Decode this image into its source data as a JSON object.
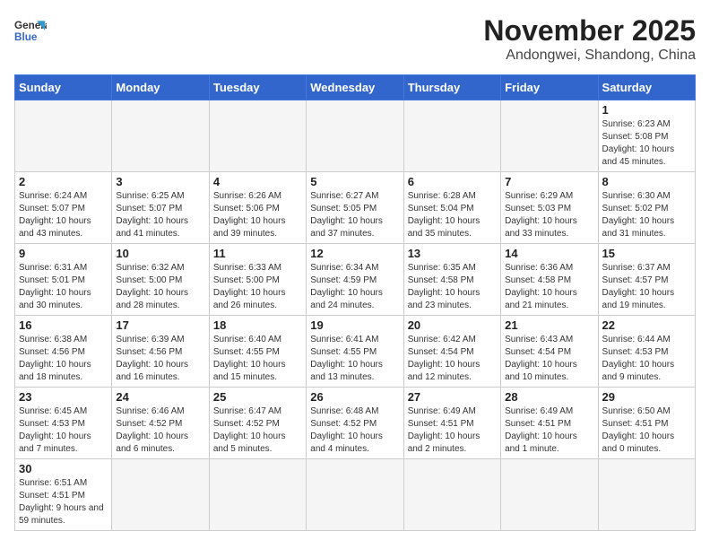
{
  "header": {
    "logo_line1": "General",
    "logo_line2": "Blue",
    "title": "November 2025",
    "subtitle": "Andongwei, Shandong, China"
  },
  "weekdays": [
    "Sunday",
    "Monday",
    "Tuesday",
    "Wednesday",
    "Thursday",
    "Friday",
    "Saturday"
  ],
  "weeks": [
    [
      {
        "day": "",
        "info": ""
      },
      {
        "day": "",
        "info": ""
      },
      {
        "day": "",
        "info": ""
      },
      {
        "day": "",
        "info": ""
      },
      {
        "day": "",
        "info": ""
      },
      {
        "day": "",
        "info": ""
      },
      {
        "day": "1",
        "info": "Sunrise: 6:23 AM\nSunset: 5:08 PM\nDaylight: 10 hours and 45 minutes."
      }
    ],
    [
      {
        "day": "2",
        "info": "Sunrise: 6:24 AM\nSunset: 5:07 PM\nDaylight: 10 hours and 43 minutes."
      },
      {
        "day": "3",
        "info": "Sunrise: 6:25 AM\nSunset: 5:07 PM\nDaylight: 10 hours and 41 minutes."
      },
      {
        "day": "4",
        "info": "Sunrise: 6:26 AM\nSunset: 5:06 PM\nDaylight: 10 hours and 39 minutes."
      },
      {
        "day": "5",
        "info": "Sunrise: 6:27 AM\nSunset: 5:05 PM\nDaylight: 10 hours and 37 minutes."
      },
      {
        "day": "6",
        "info": "Sunrise: 6:28 AM\nSunset: 5:04 PM\nDaylight: 10 hours and 35 minutes."
      },
      {
        "day": "7",
        "info": "Sunrise: 6:29 AM\nSunset: 5:03 PM\nDaylight: 10 hours and 33 minutes."
      },
      {
        "day": "8",
        "info": "Sunrise: 6:30 AM\nSunset: 5:02 PM\nDaylight: 10 hours and 31 minutes."
      }
    ],
    [
      {
        "day": "9",
        "info": "Sunrise: 6:31 AM\nSunset: 5:01 PM\nDaylight: 10 hours and 30 minutes."
      },
      {
        "day": "10",
        "info": "Sunrise: 6:32 AM\nSunset: 5:00 PM\nDaylight: 10 hours and 28 minutes."
      },
      {
        "day": "11",
        "info": "Sunrise: 6:33 AM\nSunset: 5:00 PM\nDaylight: 10 hours and 26 minutes."
      },
      {
        "day": "12",
        "info": "Sunrise: 6:34 AM\nSunset: 4:59 PM\nDaylight: 10 hours and 24 minutes."
      },
      {
        "day": "13",
        "info": "Sunrise: 6:35 AM\nSunset: 4:58 PM\nDaylight: 10 hours and 23 minutes."
      },
      {
        "day": "14",
        "info": "Sunrise: 6:36 AM\nSunset: 4:58 PM\nDaylight: 10 hours and 21 minutes."
      },
      {
        "day": "15",
        "info": "Sunrise: 6:37 AM\nSunset: 4:57 PM\nDaylight: 10 hours and 19 minutes."
      }
    ],
    [
      {
        "day": "16",
        "info": "Sunrise: 6:38 AM\nSunset: 4:56 PM\nDaylight: 10 hours and 18 minutes."
      },
      {
        "day": "17",
        "info": "Sunrise: 6:39 AM\nSunset: 4:56 PM\nDaylight: 10 hours and 16 minutes."
      },
      {
        "day": "18",
        "info": "Sunrise: 6:40 AM\nSunset: 4:55 PM\nDaylight: 10 hours and 15 minutes."
      },
      {
        "day": "19",
        "info": "Sunrise: 6:41 AM\nSunset: 4:55 PM\nDaylight: 10 hours and 13 minutes."
      },
      {
        "day": "20",
        "info": "Sunrise: 6:42 AM\nSunset: 4:54 PM\nDaylight: 10 hours and 12 minutes."
      },
      {
        "day": "21",
        "info": "Sunrise: 6:43 AM\nSunset: 4:54 PM\nDaylight: 10 hours and 10 minutes."
      },
      {
        "day": "22",
        "info": "Sunrise: 6:44 AM\nSunset: 4:53 PM\nDaylight: 10 hours and 9 minutes."
      }
    ],
    [
      {
        "day": "23",
        "info": "Sunrise: 6:45 AM\nSunset: 4:53 PM\nDaylight: 10 hours and 7 minutes."
      },
      {
        "day": "24",
        "info": "Sunrise: 6:46 AM\nSunset: 4:52 PM\nDaylight: 10 hours and 6 minutes."
      },
      {
        "day": "25",
        "info": "Sunrise: 6:47 AM\nSunset: 4:52 PM\nDaylight: 10 hours and 5 minutes."
      },
      {
        "day": "26",
        "info": "Sunrise: 6:48 AM\nSunset: 4:52 PM\nDaylight: 10 hours and 4 minutes."
      },
      {
        "day": "27",
        "info": "Sunrise: 6:49 AM\nSunset: 4:51 PM\nDaylight: 10 hours and 2 minutes."
      },
      {
        "day": "28",
        "info": "Sunrise: 6:49 AM\nSunset: 4:51 PM\nDaylight: 10 hours and 1 minute."
      },
      {
        "day": "29",
        "info": "Sunrise: 6:50 AM\nSunset: 4:51 PM\nDaylight: 10 hours and 0 minutes."
      }
    ],
    [
      {
        "day": "30",
        "info": "Sunrise: 6:51 AM\nSunset: 4:51 PM\nDaylight: 9 hours and 59 minutes."
      },
      {
        "day": "",
        "info": ""
      },
      {
        "day": "",
        "info": ""
      },
      {
        "day": "",
        "info": ""
      },
      {
        "day": "",
        "info": ""
      },
      {
        "day": "",
        "info": ""
      },
      {
        "day": "",
        "info": ""
      }
    ]
  ]
}
